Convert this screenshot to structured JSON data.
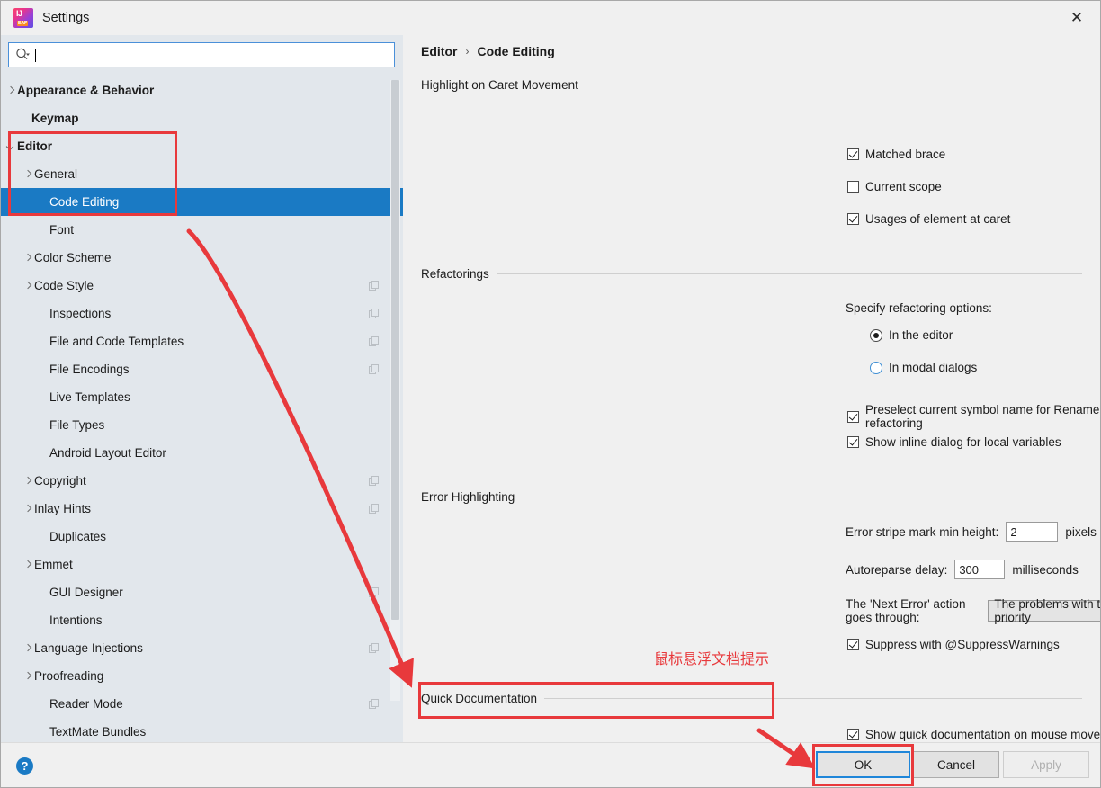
{
  "window": {
    "title": "Settings",
    "app_icon": "intellij-idea-eap-icon",
    "close_label": "✕"
  },
  "search": {
    "icon": "search-icon",
    "value": "",
    "placeholder": ""
  },
  "sidebar": {
    "items": [
      {
        "label": "Appearance & Behavior",
        "arrow": "right",
        "bold": true,
        "indent": 18,
        "selected": false,
        "badge": false
      },
      {
        "label": "Keymap",
        "arrow": "none",
        "bold": true,
        "indent": 34,
        "selected": false,
        "badge": false
      },
      {
        "label": "Editor",
        "arrow": "down",
        "bold": true,
        "indent": 18,
        "selected": false,
        "badge": false
      },
      {
        "label": "General",
        "arrow": "right",
        "bold": false,
        "indent": 37,
        "selected": false,
        "badge": false
      },
      {
        "label": "Code Editing",
        "arrow": "none",
        "bold": false,
        "indent": 54,
        "selected": true,
        "badge": false
      },
      {
        "label": "Font",
        "arrow": "none",
        "bold": false,
        "indent": 54,
        "selected": false,
        "badge": false
      },
      {
        "label": "Color Scheme",
        "arrow": "right",
        "bold": false,
        "indent": 37,
        "selected": false,
        "badge": false
      },
      {
        "label": "Code Style",
        "arrow": "right",
        "bold": false,
        "indent": 37,
        "selected": false,
        "badge": true
      },
      {
        "label": "Inspections",
        "arrow": "none",
        "bold": false,
        "indent": 54,
        "selected": false,
        "badge": true
      },
      {
        "label": "File and Code Templates",
        "arrow": "none",
        "bold": false,
        "indent": 54,
        "selected": false,
        "badge": true
      },
      {
        "label": "File Encodings",
        "arrow": "none",
        "bold": false,
        "indent": 54,
        "selected": false,
        "badge": true
      },
      {
        "label": "Live Templates",
        "arrow": "none",
        "bold": false,
        "indent": 54,
        "selected": false,
        "badge": false
      },
      {
        "label": "File Types",
        "arrow": "none",
        "bold": false,
        "indent": 54,
        "selected": false,
        "badge": false
      },
      {
        "label": "Android Layout Editor",
        "arrow": "none",
        "bold": false,
        "indent": 54,
        "selected": false,
        "badge": false
      },
      {
        "label": "Copyright",
        "arrow": "right",
        "bold": false,
        "indent": 37,
        "selected": false,
        "badge": true
      },
      {
        "label": "Inlay Hints",
        "arrow": "right",
        "bold": false,
        "indent": 37,
        "selected": false,
        "badge": true
      },
      {
        "label": "Duplicates",
        "arrow": "none",
        "bold": false,
        "indent": 54,
        "selected": false,
        "badge": false
      },
      {
        "label": "Emmet",
        "arrow": "right",
        "bold": false,
        "indent": 37,
        "selected": false,
        "badge": false
      },
      {
        "label": "GUI Designer",
        "arrow": "none",
        "bold": false,
        "indent": 54,
        "selected": false,
        "badge": true
      },
      {
        "label": "Intentions",
        "arrow": "none",
        "bold": false,
        "indent": 54,
        "selected": false,
        "badge": false
      },
      {
        "label": "Language Injections",
        "arrow": "right",
        "bold": false,
        "indent": 37,
        "selected": false,
        "badge": true
      },
      {
        "label": "Proofreading",
        "arrow": "right",
        "bold": false,
        "indent": 37,
        "selected": false,
        "badge": false
      },
      {
        "label": "Reader Mode",
        "arrow": "none",
        "bold": false,
        "indent": 54,
        "selected": false,
        "badge": true
      },
      {
        "label": "TextMate Bundles",
        "arrow": "none",
        "bold": false,
        "indent": 54,
        "selected": false,
        "badge": false
      }
    ]
  },
  "breadcrumb": {
    "parent": "Editor",
    "separator": "›",
    "current": "Code Editing"
  },
  "sections": {
    "highlight": {
      "title": "Highlight on Caret Movement",
      "matched_brace": {
        "label": "Matched brace",
        "checked": true
      },
      "current_scope": {
        "label": "Current scope",
        "checked": false
      },
      "usages": {
        "label": "Usages of element at caret",
        "checked": true
      }
    },
    "refactorings": {
      "title": "Refactorings",
      "specify_label": "Specify refactoring options:",
      "in_editor": {
        "label": "In the editor",
        "selected": true
      },
      "in_modal": {
        "label": "In modal dialogs",
        "selected": false
      },
      "preselect": {
        "label": "Preselect current symbol name for Rename refactoring",
        "checked": true
      },
      "inline_dialog": {
        "label": "Show inline dialog for local variables",
        "checked": true
      }
    },
    "error_highlighting": {
      "title": "Error Highlighting",
      "stripe_label": "Error stripe mark min height:",
      "stripe_value": "2",
      "stripe_unit": "pixels",
      "autoreparse_label": "Autoreparse delay:",
      "autoreparse_value": "300",
      "autoreparse_unit": "milliseconds",
      "next_error_label": "The 'Next Error' action goes through:",
      "next_error_value": "The problems with the highest priority",
      "suppress": {
        "label": "Suppress with @SuppressWarnings",
        "checked": true
      }
    },
    "quick_documentation": {
      "title": "Quick Documentation",
      "show_quick_doc": {
        "label": "Show quick documentation on mouse move",
        "checked": true
      }
    }
  },
  "annotations": {
    "note_text": "鼠标悬浮文档提示",
    "color": "#e8393c"
  },
  "footer": {
    "help_icon": "help-icon",
    "ok_label": "OK",
    "cancel_label": "Cancel",
    "apply_label": "Apply"
  }
}
